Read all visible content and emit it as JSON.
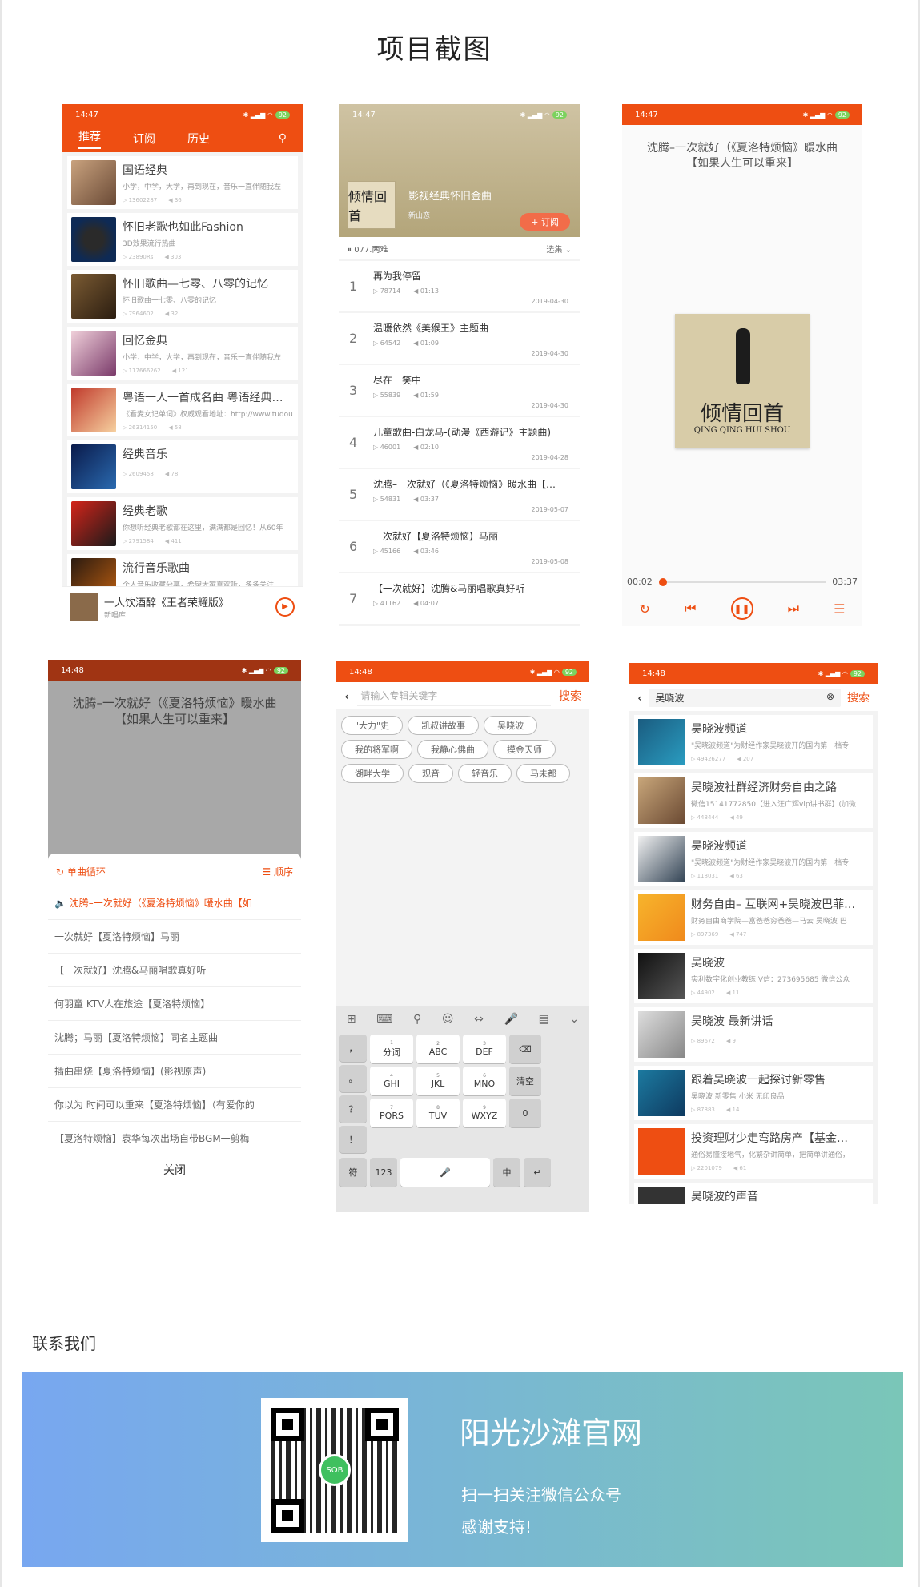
{
  "page_title": "项目截图",
  "shot1": {
    "time": "14:47",
    "battery": "92",
    "tabs": [
      "推荐",
      "订阅",
      "历史"
    ],
    "cards": [
      {
        "name": "国语经典",
        "desc": "小学，中学，大学，再到现在，音乐一直伴随我左",
        "meta": "▷ 13602287　　◀ 36"
      },
      {
        "name": "怀旧老歌也如此Fashion",
        "desc": "3D效果流行热曲",
        "meta": "▷ 23890Rs　　◀ 303"
      },
      {
        "name": "怀旧歌曲—七零、八零的记忆",
        "desc": "怀旧歌曲一七零、八零的记忆",
        "meta": "▷ 7964602　　◀ 32"
      },
      {
        "name": "回忆金典",
        "desc": "小学，中学，大学，再到现在，音乐一直伴随我左",
        "meta": "▷ 117666262　　◀ 121"
      },
      {
        "name": "粤语一人一首成名曲 粤语经典…",
        "desc": "《看麦女记单词》权威观看地址：http://www.tudou",
        "meta": "▷ 26314150　　◀ 58"
      },
      {
        "name": "经典音乐",
        "desc": "",
        "meta": "▷ 2609458　　◀ 78"
      },
      {
        "name": "经典老歌",
        "desc": "你想听经典老歌都在这里，满满都是回忆！从60年",
        "meta": "▷ 2791584　　◀ 411"
      },
      {
        "name": "流行音乐歌曲",
        "desc": "个人音乐收藏分享，希望大家喜欢听，多多关注",
        "meta": ""
      }
    ],
    "mini_title": "一人饮酒醉《王者荣耀版》",
    "mini_sub": "新唱库"
  },
  "shot2": {
    "time": "14:47",
    "album_name": "影视经典怀旧金曲",
    "author": "新山恋",
    "subscribe": "+ 订阅",
    "playing": "077.两难",
    "select": "选集",
    "tracks": [
      {
        "no": "1",
        "name": "再为我停留",
        "plays": "78714",
        "dur": "01:13",
        "date": "2019-04-30"
      },
      {
        "no": "2",
        "name": "温暖依然《美猴王》主题曲",
        "plays": "64542",
        "dur": "01:09",
        "date": "2019-04-30"
      },
      {
        "no": "3",
        "name": "尽在一笑中",
        "plays": "55839",
        "dur": "01:59",
        "date": "2019-04-30"
      },
      {
        "no": "4",
        "name": "儿童歌曲-白龙马-(动漫《西游记》主题曲)",
        "plays": "46001",
        "dur": "02:10",
        "date": "2019-04-28"
      },
      {
        "no": "5",
        "name": "沈腾–一次就好（《夏洛特烦恼》暖水曲【…",
        "plays": "54831",
        "dur": "03:37",
        "date": "2019-05-07"
      },
      {
        "no": "6",
        "name": "一次就好【夏洛特烦恼】马丽",
        "plays": "45166",
        "dur": "03:46",
        "date": "2019-05-08"
      },
      {
        "no": "7",
        "name": "【一次就好】沈腾&马丽唱歌真好听",
        "plays": "41162",
        "dur": "04:07",
        "date": ""
      }
    ]
  },
  "shot3": {
    "time": "14:47",
    "song_title": "沈腾–一次就好（《夏洛特烦恼》暖水曲【如果人生可以重来】",
    "album_cal": "倾情回首",
    "album_latin": "QING QING HUI SHOU",
    "elapsed": "00:02",
    "total": "03:37"
  },
  "shot4": {
    "time": "14:48",
    "song_title": "沈腾–一次就好（《夏洛特烦恼》暖水曲【如果人生可以重来】",
    "loop": "单曲循环",
    "order": "顺序",
    "items": [
      "沈腾–一次就好（《夏洛特烦恼》暖水曲【如",
      "一次就好【夏洛特烦恼】马丽",
      "【一次就好】沈腾&马丽唱歌真好听",
      "何羽童 KTV人在旅途【夏洛特烦恼】",
      "沈腾；马丽【夏洛特烦恼】同名主题曲",
      "插曲串烧【夏洛特烦恼】(影视原声)",
      "你以为 时间可以重来【夏洛特烦恼】（有爱你的",
      "【夏洛特烦恼】袁华每次出场自带BGM一剪梅"
    ],
    "close": "关闭"
  },
  "shot5": {
    "time": "14:48",
    "placeholder": "请输入专辑关键字",
    "search": "搜索",
    "tags": [
      "\"大力\"史",
      "凯叔讲故事",
      "吴晓波",
      "我的将军啊",
      "我静心佛曲",
      "摸金天师",
      "湖畔大学",
      "观音",
      "轻音乐",
      "马未都"
    ],
    "keys": {
      "k1": "分词",
      "k2": "ABC",
      "k3": "DEF",
      "k4": "GHI",
      "k5": "JKL",
      "k6": "MNO",
      "k7": "PQRS",
      "k8": "TUV",
      "k9": "WXYZ",
      "clear": "清空",
      "zero": "0",
      "sym": "符",
      "num": "123",
      "zh": "中",
      "n1": "1",
      "n2": "2",
      "n3": "3",
      "n4": "4",
      "n5": "5",
      "n6": "6",
      "n7": "7",
      "n8": "8",
      "n9": "9",
      "comma": "，",
      "dot": "。",
      "q": "？",
      "ex": "！"
    }
  },
  "shot6": {
    "time": "14:48",
    "query": "吴晓波",
    "search": "搜索",
    "results": [
      {
        "name": "吴晓波频道",
        "desc": "\"吴晓波频道\"为财经作家吴晓波开的国内第一档专",
        "meta": "▷ 49426277　　◀ 207"
      },
      {
        "name": "吴晓波社群经济财务自由之路",
        "desc": "微信15141772850【进入汪广辉vip讲书群】(加微",
        "meta": "▷ 448444　　◀ 49"
      },
      {
        "name": "吴晓波频道",
        "desc": "\"吴晓波频道\"为财经作家吴晓波开的国内第一档专",
        "meta": "▷ 118031　　◀ 63"
      },
      {
        "name": "财务自由– 互联网+吴晓波巴菲…",
        "desc": "财务自由商学院—富爸爸穷爸爸—马云 吴晓波 巴",
        "meta": "▷ 897369　　◀ 747"
      },
      {
        "name": "吴晓波",
        "desc": "实利数字化创业教练 V信：273695685 微信公众",
        "meta": "▷ 44902　　◀ 11"
      },
      {
        "name": "吴晓波 最新讲话",
        "desc": "",
        "meta": "▷ 89672　　◀ 9"
      },
      {
        "name": "跟着吴晓波一起探讨新零售",
        "desc": "吴晓波 新零售 小米 无印良品",
        "meta": "▷ 87883　　◀ 14"
      },
      {
        "name": "投资理财少走弯路房产【基金…",
        "desc": "通俗易懂接地气，化繁杂讲简单，把简单讲通俗，",
        "meta": "▷ 2201079　　◀ 61"
      },
      {
        "name": "吴晓波的声音",
        "desc": "",
        "meta": ""
      }
    ]
  },
  "contact": {
    "heading": "联系我们",
    "site_title": "阳光沙滩官网",
    "scan_text": "扫一扫关注微信公众号",
    "thanks": "感谢支持!",
    "qr_logo": "SOB"
  },
  "colors": {
    "accent": "#ee4e12",
    "banner_left": "#78a7f0",
    "banner_right": "#7ac6b8"
  }
}
